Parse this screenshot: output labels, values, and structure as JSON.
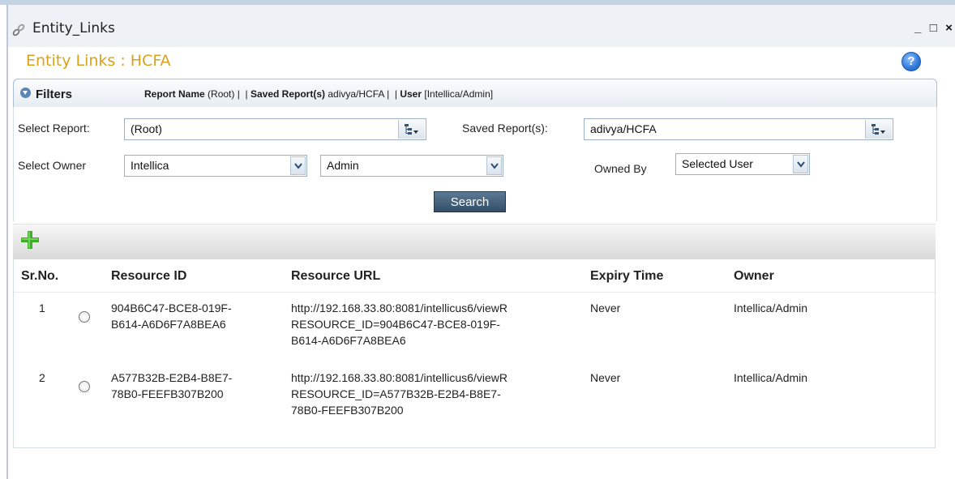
{
  "window": {
    "title": "Entity_Links",
    "controls": {
      "minimize": "_",
      "maximize": "□",
      "close": "×"
    }
  },
  "page": {
    "title": "Entity Links : HCFA",
    "help_icon": "?"
  },
  "filters": {
    "label": "Filters",
    "summary": {
      "report_name_label": "Report Name",
      "report_name_value": "(Root)",
      "saved_label": "Saved Report(s)",
      "saved_value": "adivya/HCFA",
      "user_label": "User",
      "user_value": "[Intellica/Admin]",
      "separator": "|"
    },
    "select_report": {
      "label": "Select Report:",
      "value": "(Root)"
    },
    "saved_reports": {
      "label": "Saved Report(s):",
      "value": "adivya/HCFA"
    },
    "select_owner": {
      "label": "Select Owner",
      "owner_value": "Intellica",
      "user_value": "Admin"
    },
    "owned_by": {
      "label": "Owned By",
      "value": "Selected User"
    },
    "search_button": "Search"
  },
  "toolbar": {
    "add_icon": "plus-icon"
  },
  "table": {
    "columns": [
      "Sr.No.",
      "Resource ID",
      "Resource URL",
      "Expiry Time",
      "Owner"
    ],
    "rows": [
      {
        "sr": "1",
        "resource_id_lines": [
          "904B6C47-BCE8-019F-",
          "B614-A6D6F7A8BEA6"
        ],
        "url_lines": [
          "http://192.168.33.80:8081/intellicus6/viewR",
          "RESOURCE_ID=904B6C47-BCE8-019F-",
          "B614-A6D6F7A8BEA6"
        ],
        "expiry": "Never",
        "owner": "Intellica/Admin"
      },
      {
        "sr": "2",
        "resource_id_lines": [
          "A577B32B-E2B4-B8E7-",
          "78B0-FEEFB307B200"
        ],
        "url_lines": [
          "http://192.168.33.80:8081/intellicus6/viewR",
          "RESOURCE_ID=A577B32B-E2B4-B8E7-",
          "78B0-FEEFB307B200"
        ],
        "expiry": "Never",
        "owner": "Intellica/Admin"
      }
    ]
  },
  "colors": {
    "page_title": "#d9a21c",
    "search_button": "#3d5a76",
    "add_icon": "#3cae2a",
    "help_icon": "#2f78d8"
  }
}
